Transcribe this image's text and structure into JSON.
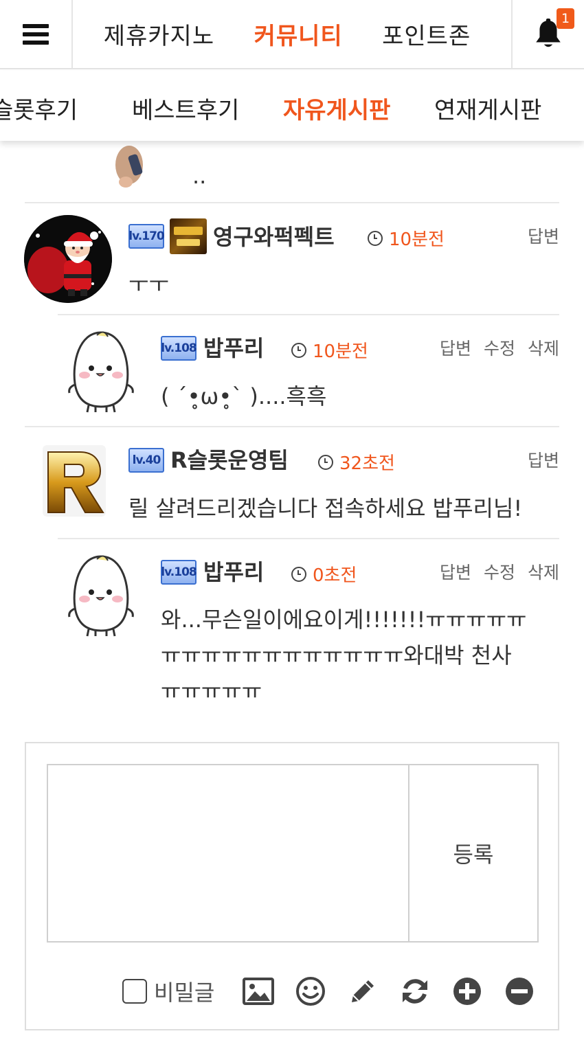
{
  "top_nav": {
    "items": [
      "제휴카지노",
      "커뮤니티",
      "포인트존"
    ],
    "active_index": 1,
    "notification_count": "1"
  },
  "sub_nav": {
    "items": [
      "슬롯후기",
      "베스트후기",
      "자유게시판",
      "연재게시판"
    ],
    "active_index": 2
  },
  "partial_comment": {
    "text": ".."
  },
  "comments": [
    {
      "level": "lv.170",
      "nick": "영구와퍽펙트",
      "time": "10분전",
      "text": "ㅜㅜ",
      "actions": [
        "답변"
      ],
      "avatar": "santa-avatar"
    },
    {
      "level": "lv.108",
      "nick": "밥푸리",
      "time": "10분전",
      "text": "( ´•̥ω•̥` )....흑흑",
      "actions": [
        "답변",
        "수정",
        "삭제"
      ],
      "avatar": "rice-avatar"
    },
    {
      "level": "lv.40",
      "nick": "R슬롯운영팀",
      "time": "32초전",
      "text": "릴 살려드리겠습니다 접속하세요 밥푸리님!",
      "actions": [
        "답변"
      ],
      "avatar": "r-logo-avatar"
    },
    {
      "level": "lv.108",
      "nick": "밥푸리",
      "time": "0초전",
      "text_lines": [
        "와...무슨일이에요이게!!!!!!!ㅠㅠㅠㅠㅠ",
        "ㅠㅠㅠㅠㅠㅠㅠㅠㅠㅠㅠㅠ와대박 천사",
        "ㅠㅠㅠㅠㅠ"
      ],
      "actions": [
        "답변",
        "수정",
        "삭제"
      ],
      "avatar": "rice-avatar"
    }
  ],
  "write_form": {
    "textarea_value": "",
    "submit_label": "등록",
    "secret_label": "비밀글",
    "secret_checked": false,
    "tools": [
      "image-icon",
      "emoji-icon",
      "pencil-icon",
      "refresh-icon",
      "plus-circle-icon",
      "minus-circle-icon"
    ]
  },
  "colors": {
    "accent": "#f0561d",
    "text": "#333333",
    "divider": "#e8e8e8"
  }
}
